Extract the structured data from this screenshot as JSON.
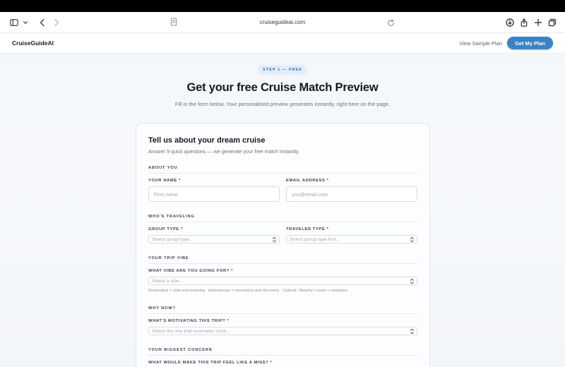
{
  "browser": {
    "url": "cruiseguideai.com"
  },
  "header": {
    "logo": "CruiseGuideAI",
    "sample_link": "View Sample Plan",
    "cta": "Get My Plan"
  },
  "hero": {
    "step": "STEP 1 — FREE",
    "title": "Get your free Cruise Match Preview",
    "subtitle": "Fill in the form below. Your personalized preview generates instantly, right here on the page."
  },
  "form": {
    "title": "Tell us about your dream cruise",
    "subtitle": "Answer 9 quick questions — we generate your free match instantly.",
    "about": {
      "section": "ABOUT YOU",
      "name_label": "YOUR NAME *",
      "name_placeholder": "First name",
      "email_label": "EMAIL ADDRESS *",
      "email_placeholder": "you@email.com"
    },
    "traveling": {
      "section": "WHO'S TRAVELING",
      "group_label": "GROUP TYPE *",
      "group_value": "Select group type...",
      "traveler_label": "TRAVELER TYPE *",
      "traveler_value": "Select group type first..."
    },
    "vibe": {
      "section": "YOUR TRIP VIBE",
      "label": "WHAT VIBE ARE YOU GOING FOR? *",
      "value": "Select a vibe...",
      "hint": "Restorative = slow and restoring · Adventurous = excursions and discovery · Cultural / Beachy = ports + relaxation"
    },
    "why": {
      "section": "WHY NOW?",
      "label": "WHAT'S MOTIVATING THIS TRIP? *",
      "value": "Select the one that resonates most..."
    },
    "concern": {
      "section": "YOUR BIGGEST CONCERN",
      "label": "WHAT WOULD MAKE THIS TRIP FEEL LIKE A MISS? *"
    }
  }
}
